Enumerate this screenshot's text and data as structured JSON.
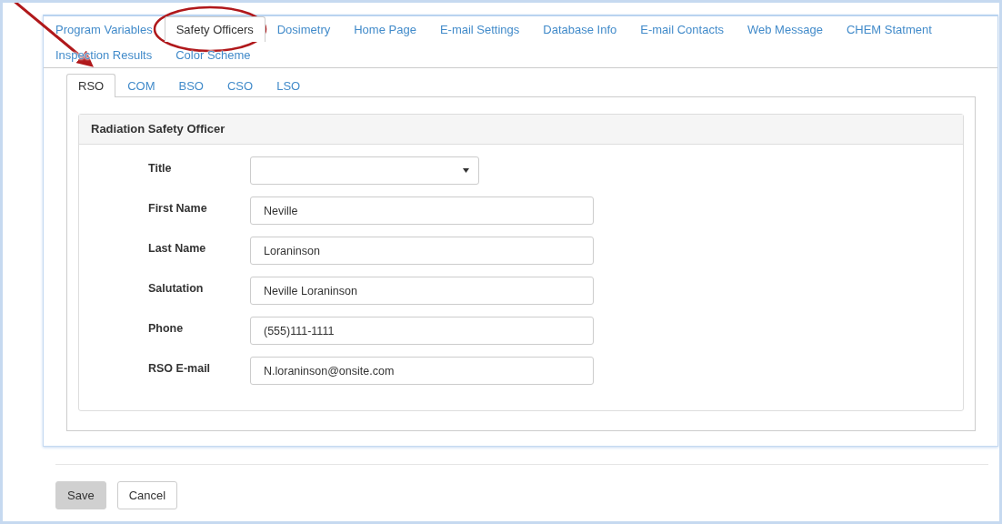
{
  "main_tabs": [
    {
      "label": "Program Variables",
      "selected": false
    },
    {
      "label": "Safety Officers",
      "selected": true
    },
    {
      "label": "Dosimetry",
      "selected": false
    },
    {
      "label": "Home Page",
      "selected": false
    },
    {
      "label": "E-mail Settings",
      "selected": false
    },
    {
      "label": "Database Info",
      "selected": false
    },
    {
      "label": "E-mail Contacts",
      "selected": false
    },
    {
      "label": "Web Message",
      "selected": false
    },
    {
      "label": "CHEM Statment",
      "selected": false
    },
    {
      "label": "Inspection Results",
      "selected": false
    },
    {
      "label": "Color Scheme",
      "selected": false
    }
  ],
  "sub_tabs": [
    {
      "label": "RSO",
      "selected": true
    },
    {
      "label": "COM",
      "selected": false
    },
    {
      "label": "BSO",
      "selected": false
    },
    {
      "label": "CSO",
      "selected": false
    },
    {
      "label": "LSO",
      "selected": false
    }
  ],
  "panel": {
    "title": "Radiation Safety Officer",
    "fields": [
      {
        "kind": "select",
        "label": "Title"
      },
      {
        "kind": "text",
        "label": "First Name",
        "value": "Neville"
      },
      {
        "kind": "text",
        "label": "Last Name",
        "value": "Loraninson"
      },
      {
        "kind": "text",
        "label": "Salutation",
        "value": "Neville Loraninson"
      },
      {
        "kind": "text",
        "label": "Phone",
        "value": "(555)111-1111"
      },
      {
        "kind": "text",
        "label": "RSO E-mail",
        "value": "N.loraninson@onsite.com"
      }
    ]
  },
  "buttons": [
    {
      "label": "Save",
      "kind": "primary"
    },
    {
      "label": "Cancel",
      "kind": "default"
    }
  ]
}
